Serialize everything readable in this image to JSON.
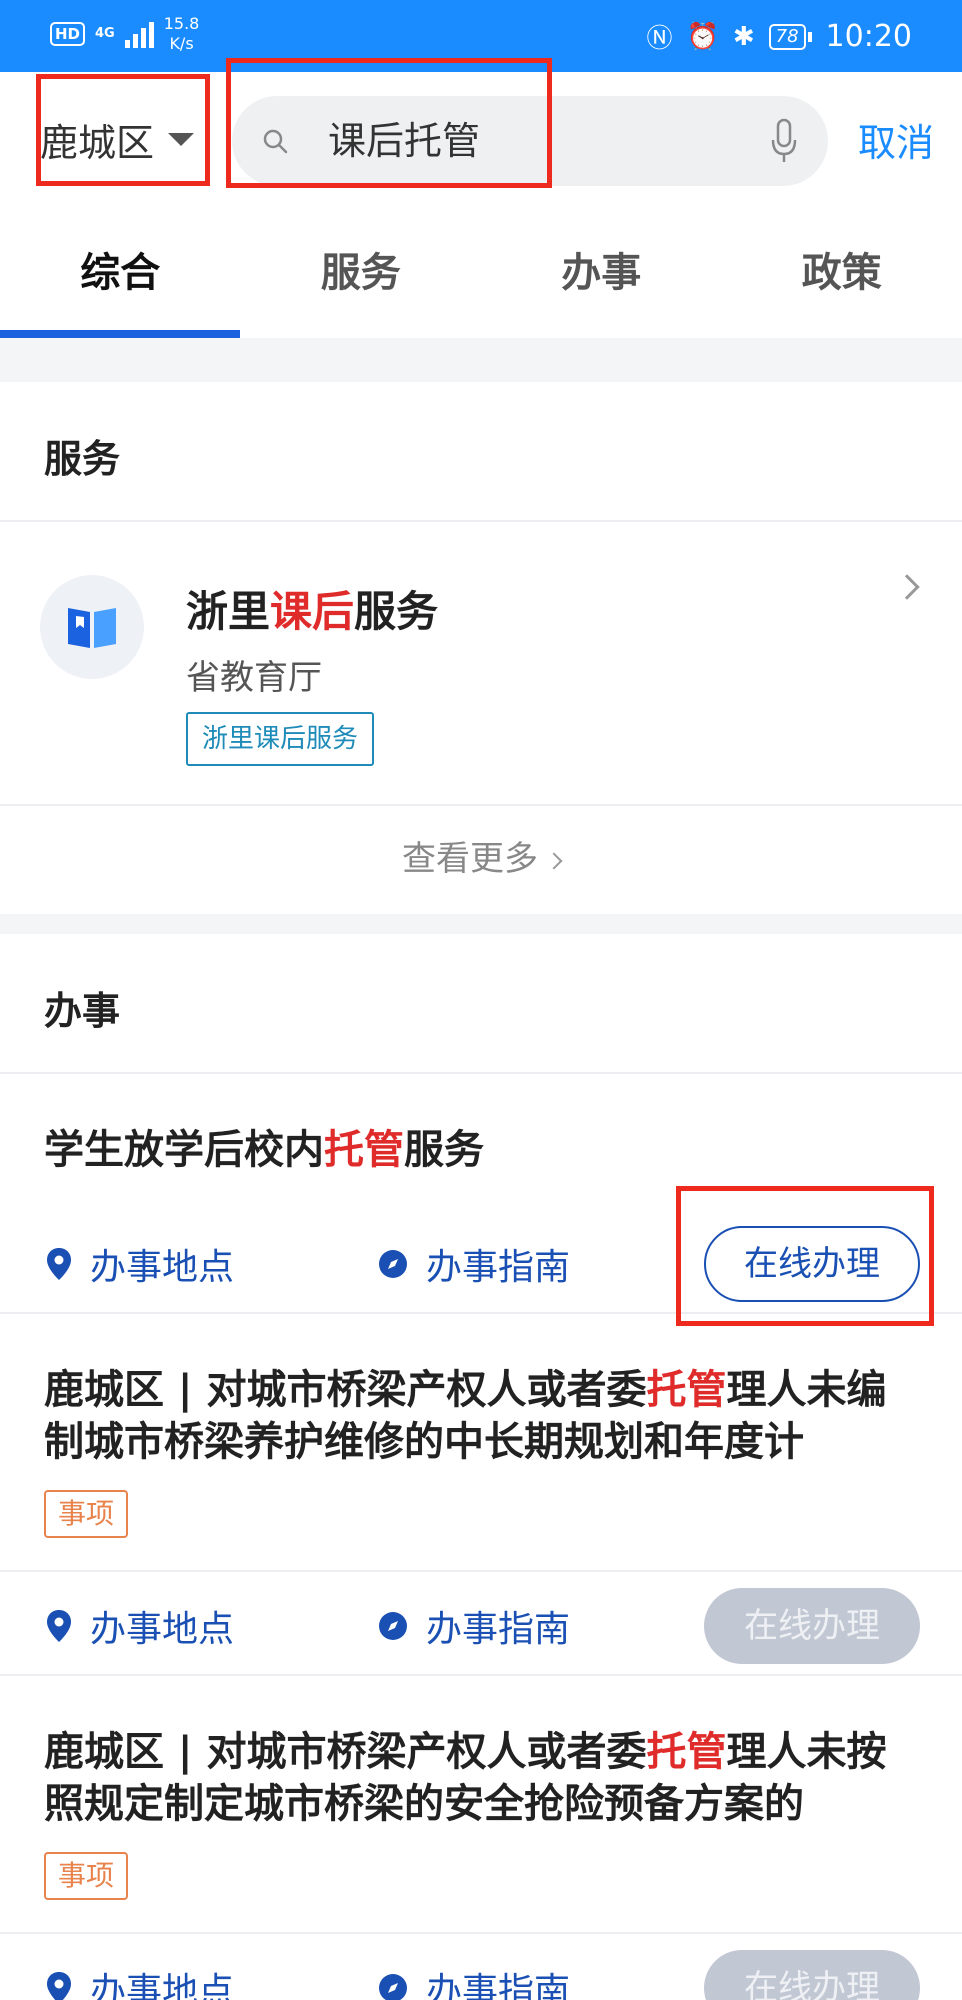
{
  "status_bar": {
    "hd": "HD",
    "network": "4G",
    "speed_value": "15.8",
    "speed_unit": "K/s",
    "battery": "78",
    "time": "10:20"
  },
  "search": {
    "region": "鹿城区",
    "query": "课后托管",
    "cancel_label": "取消"
  },
  "tabs": [
    "综合",
    "服务",
    "办事",
    "政策"
  ],
  "services_section": {
    "title": "服务",
    "item": {
      "name_prefix": "浙里",
      "name_highlight": "课后",
      "name_suffix": "服务",
      "department": "省教育厅",
      "tag": "浙里课后服务"
    },
    "more_label": "查看更多"
  },
  "affairs_section": {
    "title": "办事",
    "items": [
      {
        "title_prefix": "学生放学后校内",
        "title_highlight": "托管",
        "title_suffix": "服务",
        "location_label": "办事地点",
        "guide_label": "办事指南",
        "online_label": "在线办理",
        "online_enabled": true
      },
      {
        "title_prefix": "鹿城区 | 对城市桥梁产权人或者委",
        "title_highlight": "托管",
        "title_suffix": "理人未编制城市桥梁养护维修的中长期规划和年度计",
        "tag": "事项",
        "location_label": "办事地点",
        "guide_label": "办事指南",
        "online_label": "在线办理",
        "online_enabled": false
      },
      {
        "title_prefix": "鹿城区 | 对城市桥梁产权人或者委",
        "title_highlight": "托管",
        "title_suffix": "理人未按照规定制定城市桥梁的安全抢险预备方案的",
        "tag": "事项",
        "location_label": "办事地点",
        "guide_label": "办事指南",
        "online_label": "在线办理",
        "online_enabled": false
      }
    ]
  },
  "colors": {
    "accent": "#1a8cff",
    "highlight": "#e02b2b",
    "annotation": "#ee2a1e"
  }
}
